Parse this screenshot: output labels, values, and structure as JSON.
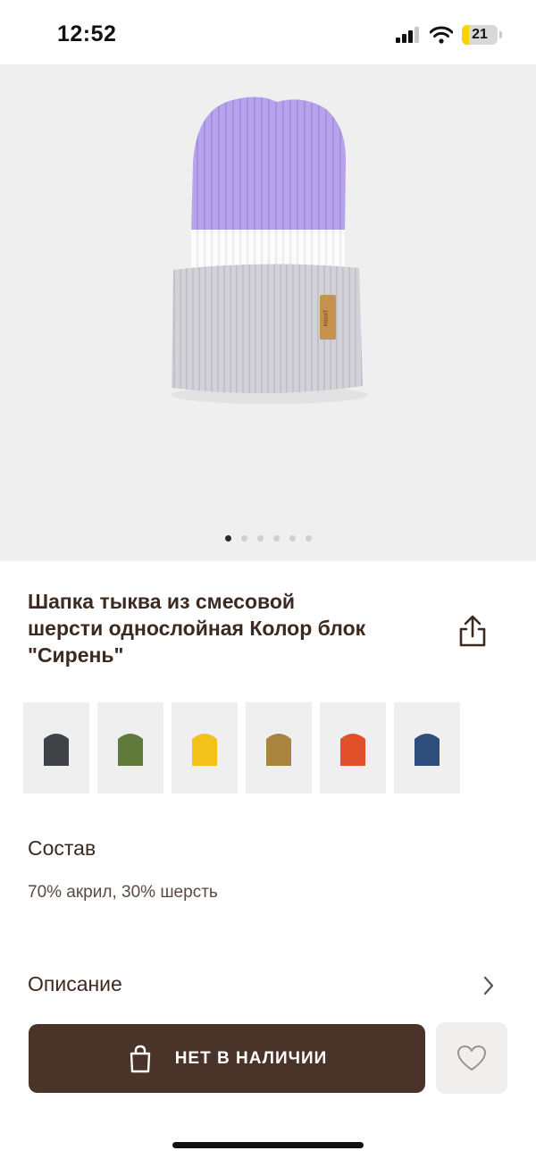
{
  "status_bar": {
    "time": "12:52",
    "battery": "21"
  },
  "gallery": {
    "image": "lavender-white-gray-knit-hat",
    "dot_count": 6,
    "active_dot": 1
  },
  "product": {
    "title_line1": "Шапка тыква из смесовой",
    "title_line2": "шерсти однослойная Колор блок",
    "title_line3": "\"Сирень\""
  },
  "color_swatches": [
    {
      "name": "dark-gray",
      "color": "#3f4247"
    },
    {
      "name": "olive-green",
      "color": "#5f7a3a"
    },
    {
      "name": "yellow",
      "color": "#f2c21a"
    },
    {
      "name": "mustard-brown",
      "color": "#a8843f"
    },
    {
      "name": "orange-red",
      "color": "#e0502a"
    },
    {
      "name": "navy-blue",
      "color": "#2f4d7a"
    }
  ],
  "composition": {
    "label": "Состав",
    "value": "70% акрил, 30% шерсть"
  },
  "description": {
    "label": "Описание"
  },
  "actions": {
    "cart_label": "НЕТ В НАЛИЧИИ"
  },
  "colors": {
    "brand_brown": "#4a3429",
    "text": "#3b2a21"
  },
  "icons": [
    "signal-icon",
    "wifi-icon",
    "battery-icon",
    "share-icon",
    "chevron-right-icon",
    "shopping-bag-icon",
    "heart-icon"
  ]
}
